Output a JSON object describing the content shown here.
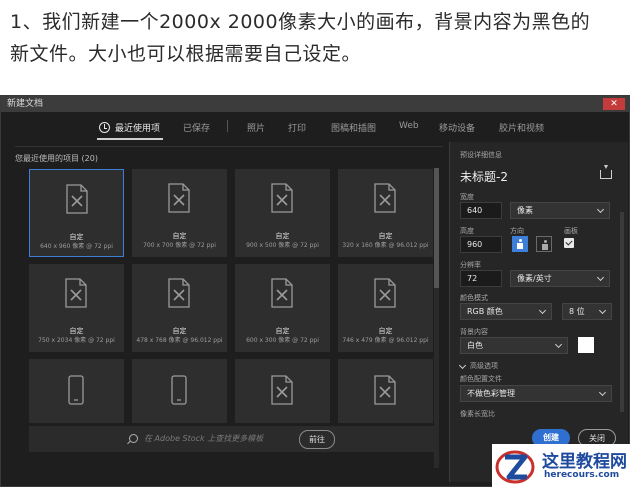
{
  "caption": "1、我们新建一个2000x 2000像素大小的画布，背景内容为黑色的新文件。大小也可以根据需要自己设定。",
  "window": {
    "title": "新建文档"
  },
  "tabs": [
    {
      "label": "最近使用项"
    },
    {
      "label": "已保存"
    },
    {
      "label": "照片"
    },
    {
      "label": "打印"
    },
    {
      "label": "图稿和插图"
    },
    {
      "label": "Web"
    },
    {
      "label": "移动设备"
    },
    {
      "label": "胶片和视频"
    }
  ],
  "recent": {
    "label": "您最近使用的项目",
    "count": "(20)",
    "items": [
      {
        "name": "自定",
        "size": "640 x 960 像素 @ 72 ppi"
      },
      {
        "name": "自定",
        "size": "700 x 700 像素 @ 72 ppi"
      },
      {
        "name": "自定",
        "size": "900 x 500 像素 @ 72 ppi"
      },
      {
        "name": "自定",
        "size": "320 x 160 像素 @ 96.012 ppi"
      },
      {
        "name": "自定",
        "size": "750 x 2034 像素 @ 72 ppi"
      },
      {
        "name": "自定",
        "size": "478 x 768 像素 @ 96.012 ppi"
      },
      {
        "name": "自定",
        "size": "600 x 300 像素 @ 72 ppi"
      },
      {
        "name": "自定",
        "size": "746 x 479 像素 @ 96.012 ppi"
      }
    ]
  },
  "stock": {
    "placeholder": "在 Adobe Stock 上查找更多模板",
    "go_label": "前往"
  },
  "preset": {
    "section_label": "预设详细信息",
    "name": "未标题-2",
    "width_label": "宽度",
    "width_value": "640",
    "width_unit": "像素",
    "height_label": "高度",
    "height_value": "960",
    "orientation_label": "方向",
    "artboard_label": "画板",
    "resolution_label": "分辨率",
    "resolution_value": "72",
    "resolution_unit": "像素/英寸",
    "color_mode_label": "颜色模式",
    "color_mode_value": "RGB 颜色",
    "bit_depth_value": "8 位",
    "background_label": "背景内容",
    "background_value": "白色",
    "advanced_label": "高级选项",
    "color_profile_label": "颜色配置文件",
    "color_profile_value": "不做色彩管理",
    "pixel_aspect_label": "像素长宽比"
  },
  "buttons": {
    "create": "创建",
    "close": "关闭"
  },
  "watermark": {
    "title": "这里教程网",
    "url": "herecours.com"
  },
  "colors": {
    "accent": "#3d7ed8",
    "dialog_bg": "#1e1e1e",
    "card_bg": "#2e2e2e",
    "watermark_blue": "#1f4b9e"
  }
}
